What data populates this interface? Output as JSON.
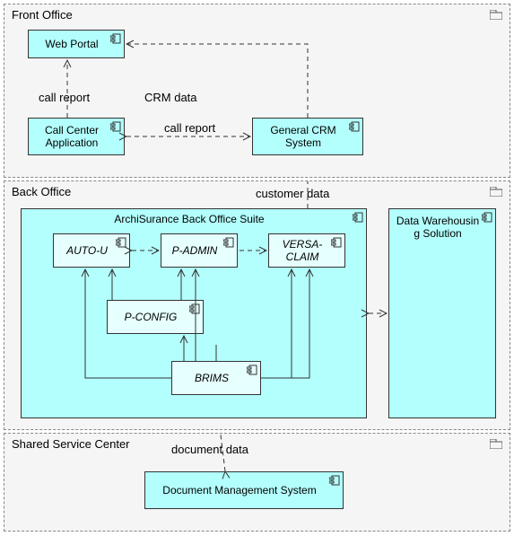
{
  "packages": {
    "front": "Front Office",
    "back": "Back Office",
    "shared": "Shared Service Center"
  },
  "suite": "ArchiSurance Back Office Suite",
  "components": {
    "web_portal": "Web Portal",
    "call_center": "Call Center Application",
    "crm": "General CRM System",
    "auto_u": "AUTO-U",
    "p_admin": "P-ADMIN",
    "versa": "VERSA-CLAIM",
    "p_config": "P-CONFIG",
    "brims": "BRIMS",
    "dw": "Data Warehousin g Solution",
    "dms": "Document Management System"
  },
  "labels": {
    "call_report_v": "call report",
    "crm_data": "CRM data",
    "call_report_h": "call report",
    "customer_data": "customer data",
    "document_data": "document data"
  },
  "chart_data": {
    "type": "diagram",
    "title": "ArchiMate application component diagram",
    "packages": [
      {
        "name": "Front Office",
        "components": [
          "Web Portal",
          "Call Center Application",
          "General CRM System"
        ]
      },
      {
        "name": "Back Office",
        "components": [
          "ArchiSurance Back Office Suite",
          "Data Warehousing Solution"
        ],
        "nested": {
          "ArchiSurance Back Office Suite": [
            "AUTO-U",
            "P-ADMIN",
            "VERSA-CLAIM",
            "P-CONFIG",
            "BRIMS"
          ]
        }
      },
      {
        "name": "Shared Service Center",
        "components": [
          "Document Management System"
        ]
      }
    ],
    "relations": [
      {
        "from": "Call Center Application",
        "to": "Web Portal",
        "label": "call report",
        "style": "dashed-open-arrow",
        "bidir": false
      },
      {
        "from": "General CRM System",
        "to": "Web Portal",
        "label": "CRM data",
        "style": "dashed-open-arrow",
        "bidir": false
      },
      {
        "from": "Call Center Application",
        "to": "General CRM System",
        "label": "call report",
        "style": "dashed-open-arrow",
        "bidir": true
      },
      {
        "from": "ArchiSurance Back Office Suite",
        "to": "General CRM System",
        "label": "customer data",
        "style": "dashed-open-arrow",
        "bidir": false
      },
      {
        "from": "AUTO-U",
        "to": "P-ADMIN",
        "style": "dashed-open-arrow",
        "bidir": true
      },
      {
        "from": "P-ADMIN",
        "to": "VERSA-CLAIM",
        "style": "dashed-open-arrow",
        "bidir": false
      },
      {
        "from": "ArchiSurance Back Office Suite",
        "to": "Data Warehousing Solution",
        "style": "dashed-open-arrow",
        "bidir": true
      },
      {
        "from": "BRIMS",
        "to": "AUTO-U",
        "style": "solid-open-arrow"
      },
      {
        "from": "BRIMS",
        "to": "P-ADMIN",
        "style": "solid-open-arrow"
      },
      {
        "from": "BRIMS",
        "to": "P-CONFIG",
        "style": "solid-open-arrow"
      },
      {
        "from": "BRIMS",
        "to": "VERSA-CLAIM",
        "style": "solid-open-arrow"
      },
      {
        "from": "P-CONFIG",
        "to": "AUTO-U",
        "style": "solid-open-arrow"
      },
      {
        "from": "P-CONFIG",
        "to": "P-ADMIN",
        "style": "solid-open-arrow"
      },
      {
        "from": "Document Management System",
        "to": "BRIMS",
        "label": "document data",
        "style": "dashed-open-arrow",
        "bidir": true
      }
    ]
  }
}
